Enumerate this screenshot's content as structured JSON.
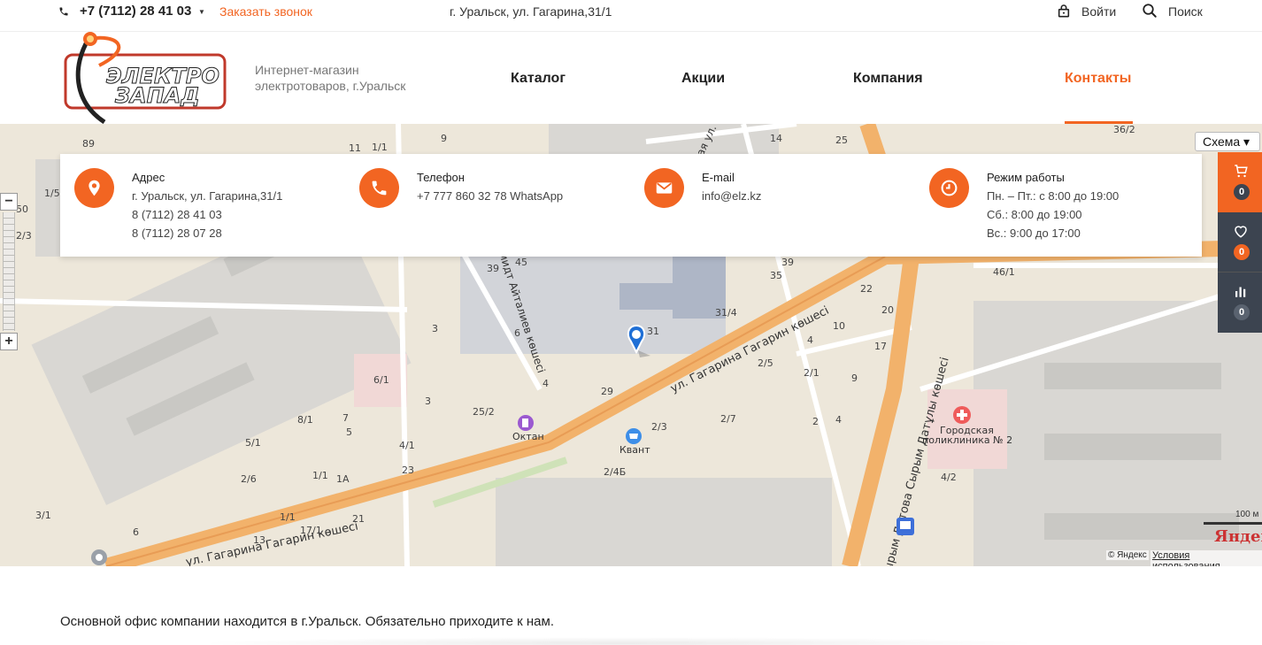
{
  "topbar": {
    "phone": "+7 (7112) 28 41 03",
    "callback": "Заказать звонок",
    "address": "г. Уральск, ул. Гагарина,31/1",
    "login": "Войти",
    "search": "Поиск"
  },
  "header": {
    "logo_text_top": "ЭЛЕКТРО",
    "logo_text_bottom": "ЗАПАД",
    "tagline_line1": "Интернет-магазин",
    "tagline_line2": "электротоваров, г.Уральск",
    "nav": [
      "Каталог",
      "Акции",
      "Компания",
      "Контакты"
    ],
    "active_nav": "Контакты"
  },
  "map": {
    "scheme_button": "Схема",
    "zoom_in": "+",
    "zoom_out": "−",
    "scale": "100 м",
    "logo": "Яндекс",
    "copyright": "© Яндекс",
    "terms": "Условия использования",
    "streets": [
      "ул. Гагарина  Гагарин көшесі",
      "ул. Гагарина  Гагарин көшесі",
      "Сырым Датова Сырым Датұлы көшесі",
      "Шмидт Айталиев көшесі",
      "ская ул."
    ],
    "pois": [
      "Октан",
      "Квант",
      "Городская",
      "поликлиника № 2"
    ],
    "house_numbers": [
      "89",
      "9",
      "14",
      "25",
      "36/2",
      "11",
      "39",
      "45",
      "39",
      "35",
      "22",
      "46/1",
      "31/4",
      "31",
      "20",
      "3",
      "6",
      "10",
      "4",
      "17",
      "2/5",
      "2/1",
      "9",
      "6/1",
      "3",
      "4",
      "29",
      "8/1",
      "7",
      "25/2",
      "2/3",
      "2/7",
      "2",
      "4",
      "5",
      "4/1",
      "5/1",
      "23",
      "2/6",
      "1/1",
      "1А",
      "2/4Б",
      "4/2",
      "3/1",
      "1/1",
      "21",
      "17/1",
      "13",
      "11",
      "1/5",
      "2/3",
      "6",
      "1/1",
      "50"
    ]
  },
  "contacts": {
    "address": {
      "title": "Адрес",
      "lines": [
        "г. Уральск, ул. Гагарина,31/1",
        "8 (7112) 28 41 03",
        "8 (7112) 28 07 28"
      ]
    },
    "phone": {
      "title": "Телефон",
      "lines": [
        "+7 777 860 32 78 WhatsApp"
      ]
    },
    "email": {
      "title": "E-mail",
      "lines": [
        "info@elz.kz"
      ]
    },
    "hours": {
      "title": "Режим работы",
      "lines": [
        "Пн. – Пт.: с 8:00 до 19:00",
        "Сб.: 8:00 до 19:00",
        "Вс.: 9:00 до 17:00"
      ]
    }
  },
  "side_panel": {
    "cart_count": "0",
    "favorites_count": "0",
    "compare_count": "0"
  },
  "body": {
    "text": "Основной офис компании находится в г.Уральск. Обязательно приходите к нам."
  },
  "colors": {
    "accent": "#f26522",
    "panel_dark": "#3c4450",
    "road_main": "#f2b26b",
    "map_bg": "#ede7da"
  }
}
